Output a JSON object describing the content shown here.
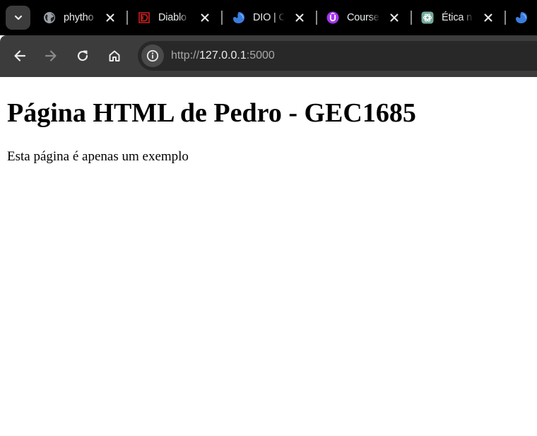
{
  "colors": {
    "tabstrip_bg": "#000000",
    "toolbar_bg": "#3c3c3c",
    "omnibox_bg": "#282828",
    "page_bg": "#ffffff",
    "dio_blue": "#3b7ddd",
    "diablo_red": "#c62020",
    "udemy_purple": "#a435f0",
    "chatgpt_green": "#74aa9c"
  },
  "tabs": [
    {
      "title": "phytho",
      "icon": "globe-icon"
    },
    {
      "title": "Diablo",
      "icon": "diablo-icon"
    },
    {
      "title": "DIO | C",
      "icon": "dio-icon"
    },
    {
      "title": "Course",
      "icon": "udemy-icon"
    },
    {
      "title": "Ética n",
      "icon": "chatgpt-icon"
    }
  ],
  "toolbar": {
    "url_scheme": "http://",
    "url_host": "127.0.0.1",
    "url_port": ":5000"
  },
  "page": {
    "heading": "Página HTML de Pedro - GEC1685",
    "paragraph": "Esta página é apenas um exemplo"
  }
}
